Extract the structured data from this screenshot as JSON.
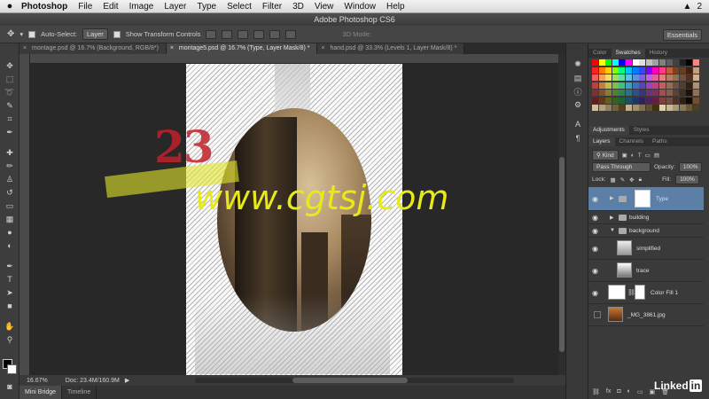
{
  "menubar": {
    "app": "Photoshop",
    "items": [
      "File",
      "Edit",
      "Image",
      "Layer",
      "Type",
      "Select",
      "Filter",
      "3D",
      "View",
      "Window",
      "Help"
    ],
    "right_badge": "2"
  },
  "window_title": "Adobe Photoshop CS6",
  "options": {
    "auto_select_label": "Auto-Select:",
    "auto_select_value": "Layer",
    "transform_label": "Show Transform Controls",
    "mode_3d": "3D Mode:",
    "workspace": "Essentials"
  },
  "tabs": [
    {
      "label": "montage.psd @ 16.7% (Background, RGB/8*)",
      "active": false
    },
    {
      "label": "montage5.psd @ 16.7% (Type, Layer Mask/8) *",
      "active": true
    },
    {
      "label": "hand.psd @ 33.3% (Levels 1, Layer Mask/8) *",
      "active": false
    }
  ],
  "canvas": {
    "number_text": "23",
    "watermark": "www.cgtsj.com"
  },
  "status": {
    "zoom": "16.67%",
    "doc": "Doc: 23.4M/160.9M"
  },
  "bridge_tabs": [
    "Mini Bridge",
    "Timeline"
  ],
  "panels": {
    "color_tabs": [
      "Color",
      "Swatches",
      "History"
    ],
    "color_active": "Swatches",
    "adj_tabs": [
      "Adjustments",
      "Styles"
    ],
    "layer_tabs": [
      "Layers",
      "Channels",
      "Paths"
    ],
    "kind_label": "Kind",
    "blend_mode": "Pass Through",
    "opacity_label": "Opacity:",
    "opacity_value": "100%",
    "lock_label": "Lock:",
    "fill_label": "Fill:",
    "fill_value": "100%",
    "layers": [
      {
        "name": "Type",
        "kind": "group-masked",
        "visible": true,
        "selected": true
      },
      {
        "name": "building",
        "kind": "group",
        "visible": true,
        "selected": false
      },
      {
        "name": "background",
        "kind": "group-open",
        "visible": true,
        "selected": false
      },
      {
        "name": "simplified",
        "kind": "layer",
        "visible": true,
        "selected": false
      },
      {
        "name": "trace",
        "kind": "layer",
        "visible": true,
        "selected": false
      },
      {
        "name": "Color Fill 1",
        "kind": "fill",
        "visible": true,
        "selected": false
      },
      {
        "name": "_MG_3861.jpg",
        "kind": "image",
        "visible": false,
        "selected": false
      }
    ]
  },
  "brand": {
    "pre": "Linked",
    "in": "in"
  },
  "colors": {
    "accent": "#e6ea18",
    "selection": "#5b7fa6",
    "red": "#c0202a"
  },
  "icons": [
    "apple-icon",
    "move-tool-icon",
    "eye-icon",
    "folder-icon",
    "search-icon",
    "lock-icon"
  ]
}
